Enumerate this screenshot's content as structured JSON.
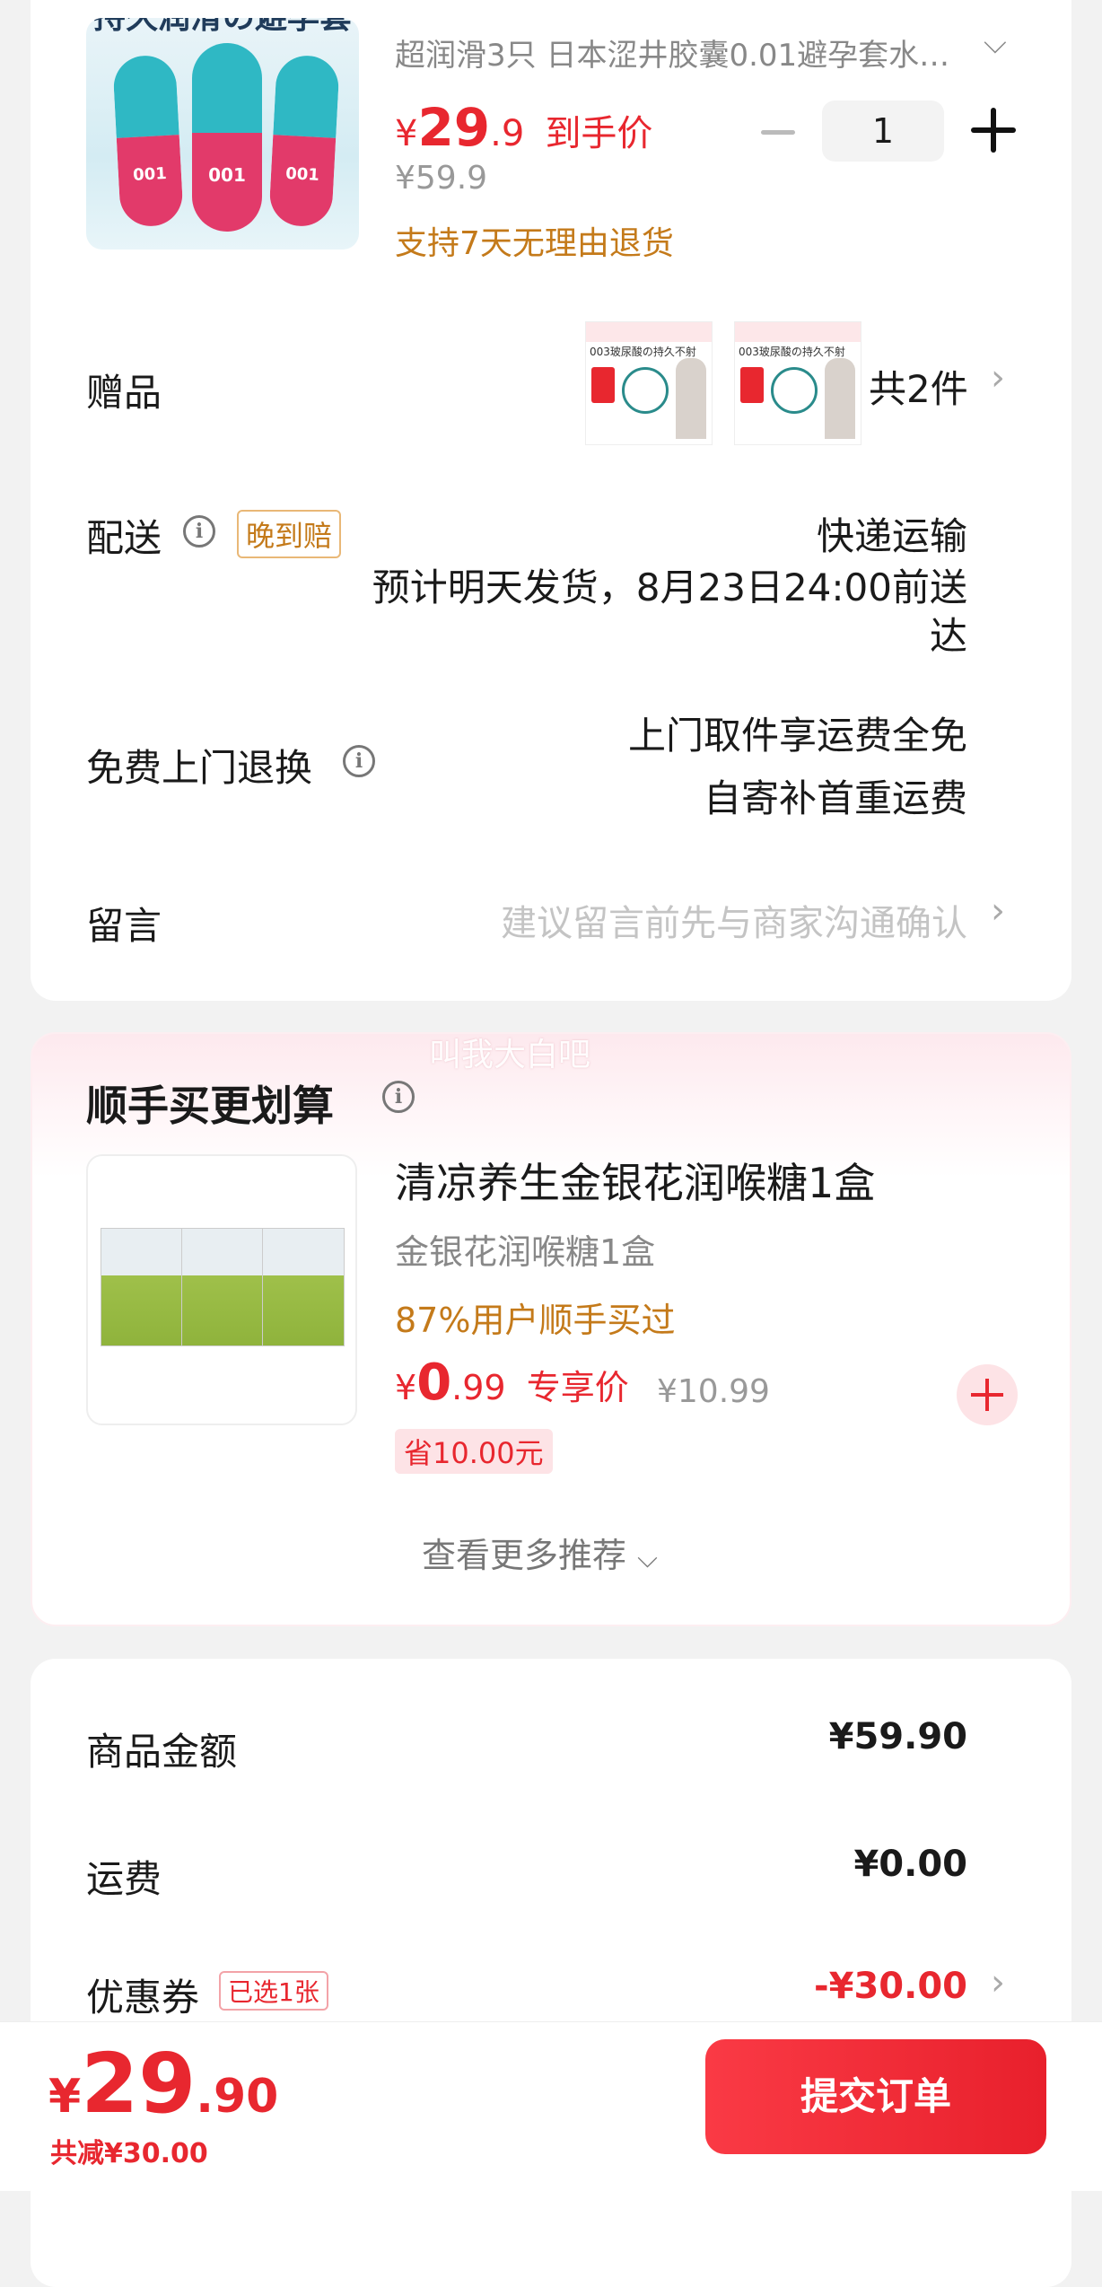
{
  "product": {
    "image_text": "持久润滑の避孕套",
    "capsule_label": "001",
    "title": "超润滑3只 日本涩井胶囊0.01避孕套水…",
    "price_symbol": "¥",
    "price_int": "29",
    "price_dec": ".9",
    "price_tag": "到手价",
    "qty": "1",
    "original_price": "¥59.9",
    "return_policy": "支持7天无理由退货"
  },
  "gift": {
    "label": "赠品",
    "count": "共2件",
    "thumb_text": "003玻尿酸の持久不射"
  },
  "delivery": {
    "label": "配送",
    "badge": "晚到赔",
    "method": "快递运输",
    "eta_line1": "预计明天发货，8月23日24:00前送",
    "eta_line2": "达"
  },
  "returns": {
    "label": "免费上门退换",
    "line1": "上门取件享运费全免",
    "line2": "自寄补首重运费"
  },
  "message": {
    "label": "留言",
    "placeholder": "建议留言前先与商家沟通确认"
  },
  "watermark": "叫我大白吧",
  "addon": {
    "section_title": "顺手买更划算",
    "item_title": "清凉养生金银花润喉糖1盒",
    "item_sub": "金银花润喉糖1盒",
    "buy_rate": "87%用户顺手买过",
    "price_symbol": "¥",
    "price_int": "0",
    "price_dec": ".99",
    "price_tag": "专享价",
    "original_price": "¥10.99",
    "save": "省10.00元",
    "more": "查看更多推荐"
  },
  "summary": {
    "goods_label": "商品金额",
    "goods_value": "¥59.90",
    "ship_label": "运费",
    "ship_value": "¥0.00",
    "coupon_label": "优惠券",
    "coupon_badge": "已选1张",
    "coupon_value": "-¥30.00"
  },
  "footer": {
    "price_symbol": "¥",
    "price_int": "29",
    "price_dec": ".90",
    "discount": "共减¥30.00",
    "submit": "提交订单"
  },
  "colors": {
    "accent": "#e8272f",
    "gold": "#c47a1a",
    "submit_from": "#fa3a45",
    "submit_to": "#e8202c"
  }
}
